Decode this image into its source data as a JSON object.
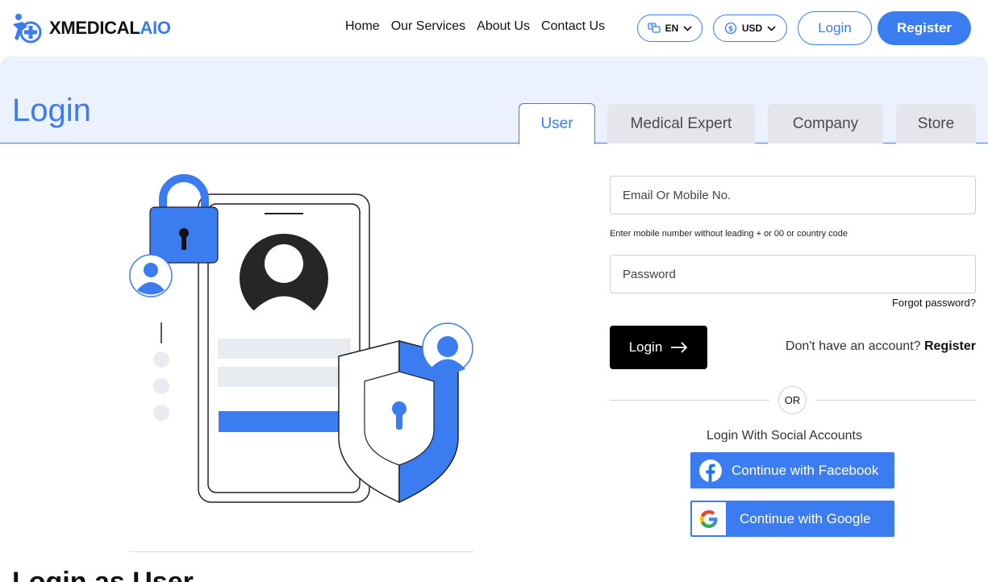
{
  "brand": {
    "name_part1": "XMEDICAL",
    "name_part2": "AIO",
    "primary_color": "#3b7cf0"
  },
  "nav": {
    "items": [
      "Home",
      "Our Services",
      "About Us",
      "Contact Us"
    ]
  },
  "language": {
    "value": "EN"
  },
  "currency": {
    "value": "USD"
  },
  "header_buttons": {
    "login": "Login",
    "register": "Register"
  },
  "page": {
    "title": "Login"
  },
  "tabs": [
    {
      "label": "User",
      "active": true
    },
    {
      "label": "Medical Expert",
      "active": false
    },
    {
      "label": "Company",
      "active": false
    },
    {
      "label": "Store",
      "active": false
    }
  ],
  "form": {
    "email_placeholder": "Email Or Mobile No.",
    "email_hint": "Enter mobile number without leading + or 00 or country code",
    "password_placeholder": "Password",
    "forgot": "Forgot password?",
    "submit": "Login",
    "no_account": "Don't have an account?",
    "register_link": "Register",
    "or": "OR"
  },
  "social": {
    "label": "Login With Social Accounts",
    "facebook": "Continue with Facebook",
    "google": "Continue with Google"
  },
  "section_heading": "Login as User"
}
